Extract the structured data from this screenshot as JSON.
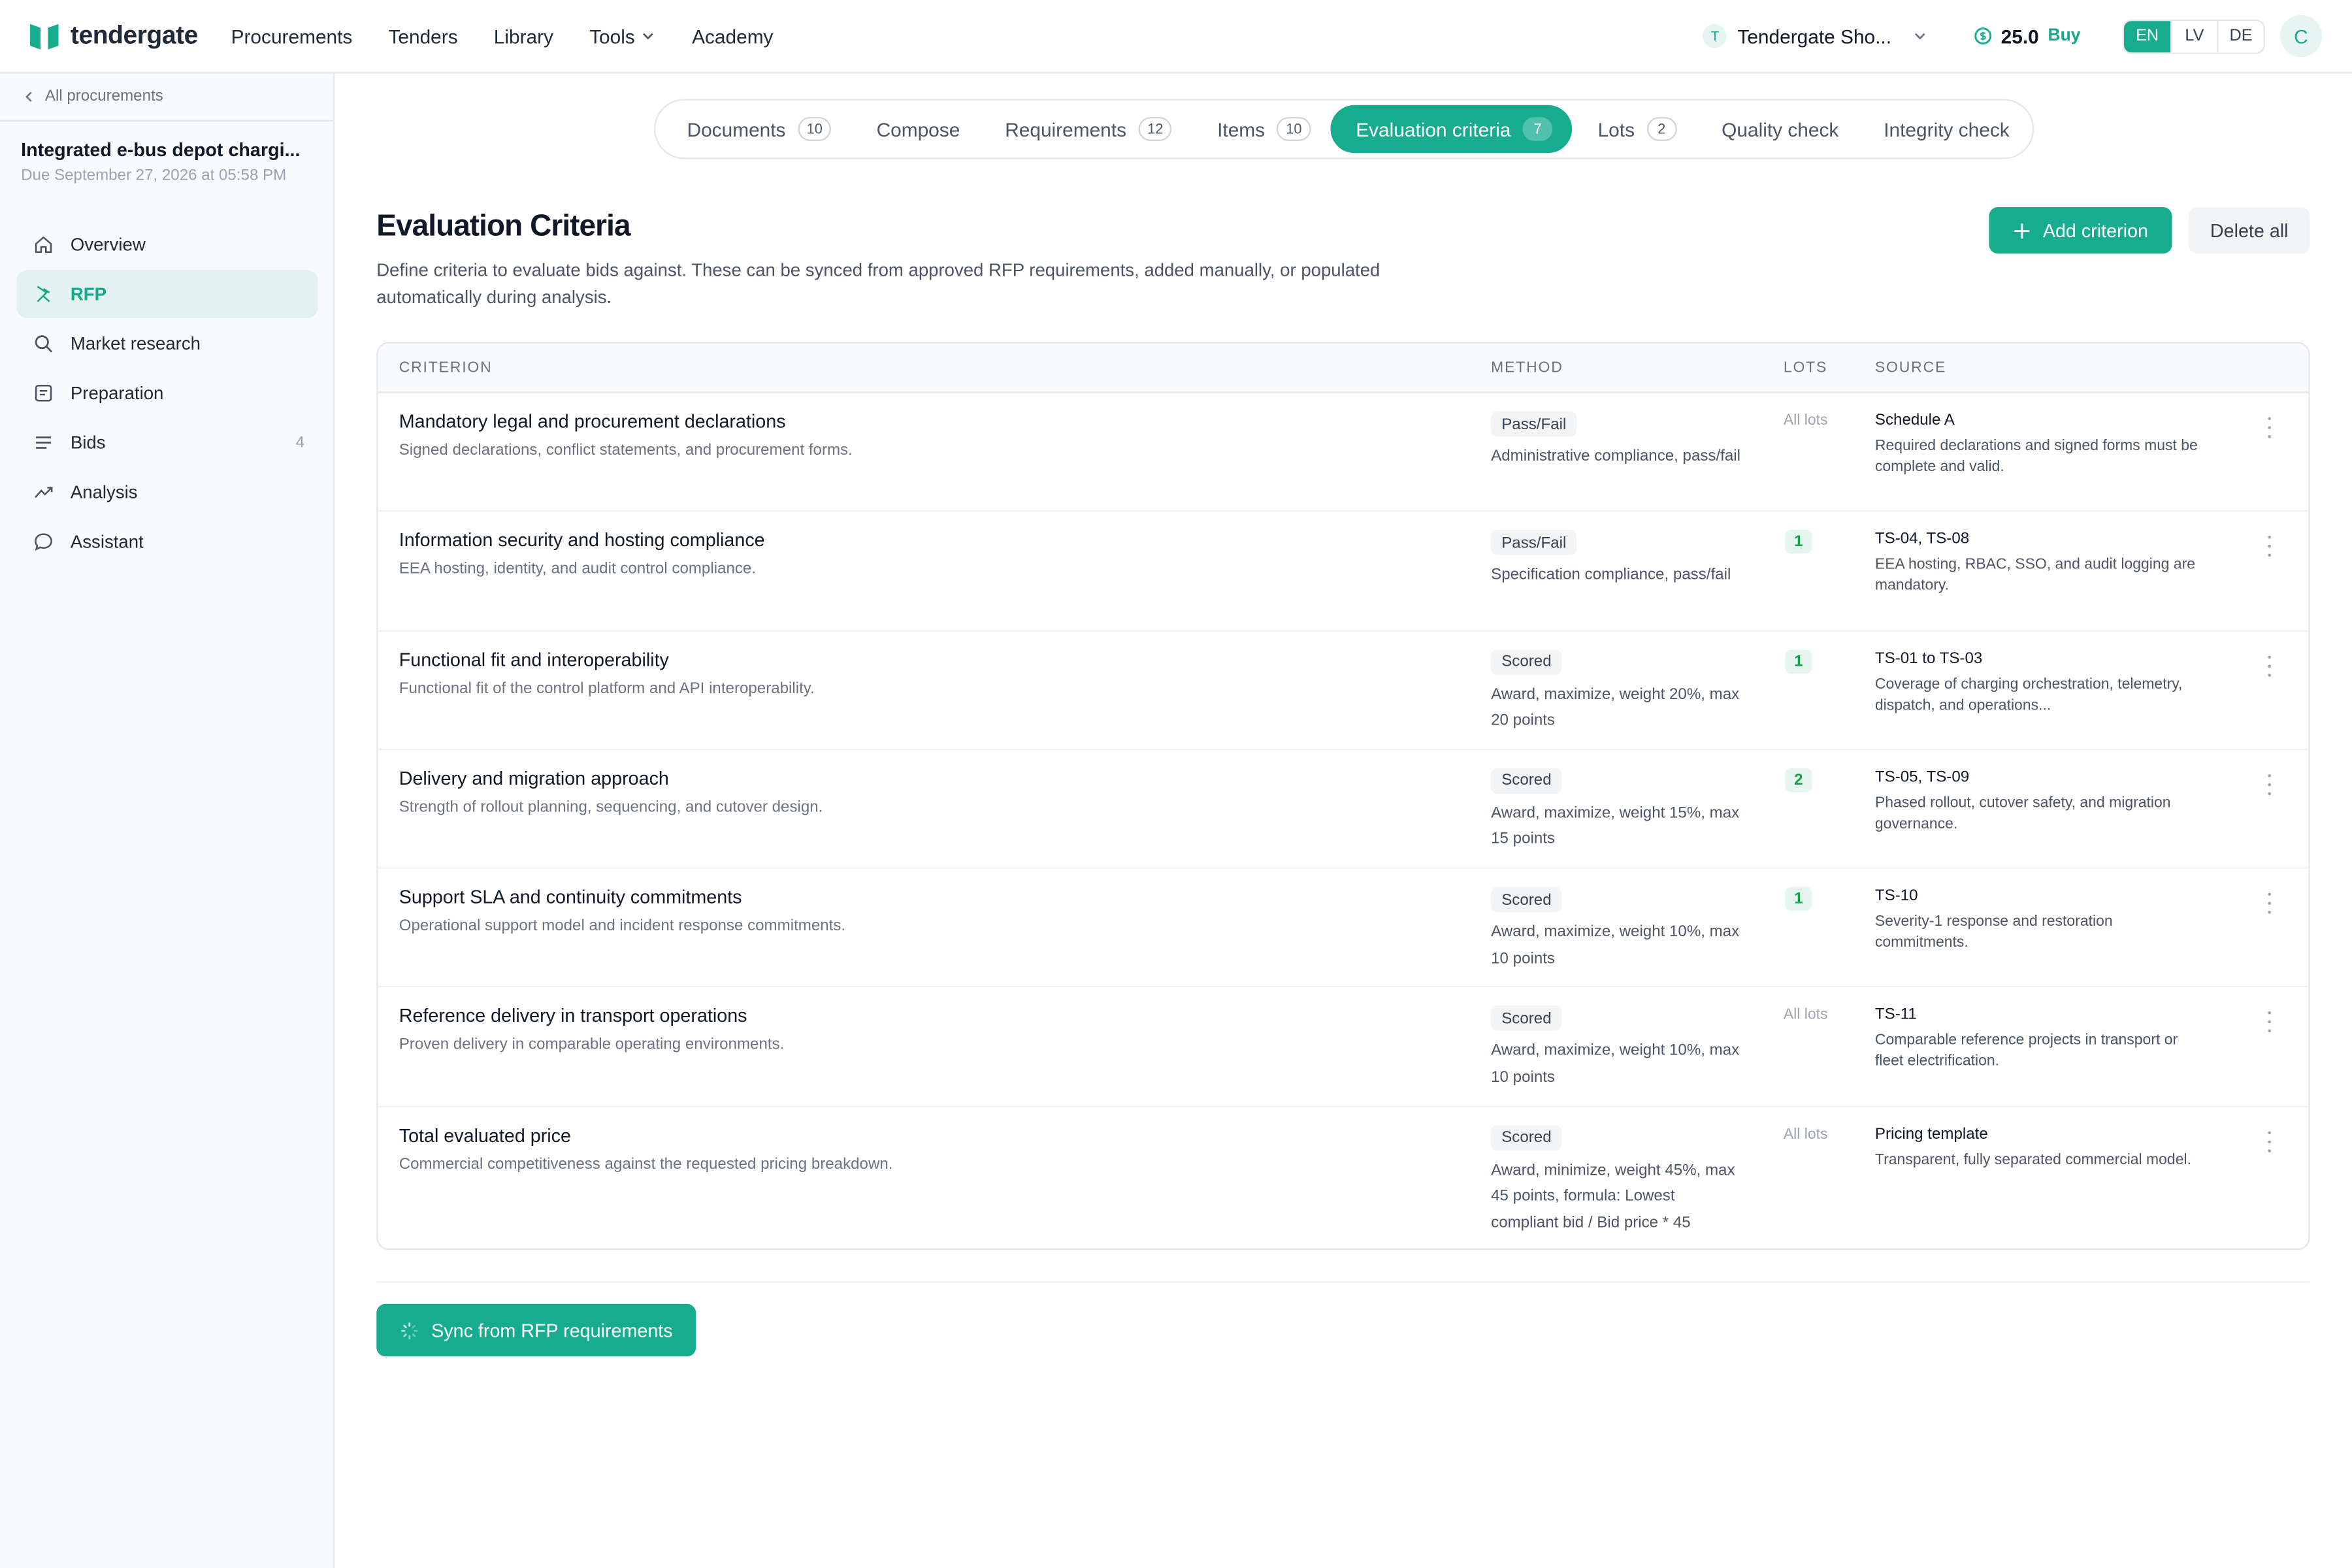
{
  "app": {
    "brand": "tendergate"
  },
  "topnav": [
    {
      "label": "Procurements"
    },
    {
      "label": "Tenders"
    },
    {
      "label": "Library"
    },
    {
      "label": "Tools",
      "has_dropdown": true
    },
    {
      "label": "Academy"
    }
  ],
  "org": {
    "initial": "T",
    "name": "Tendergate Sho..."
  },
  "credits": {
    "value": "25.0",
    "buy_label": "Buy"
  },
  "languages": [
    {
      "code": "EN",
      "active": true
    },
    {
      "code": "LV",
      "active": false
    },
    {
      "code": "DE",
      "active": false
    }
  ],
  "user": {
    "initial": "C"
  },
  "sidebar": {
    "back_label": "All procurements",
    "project_title": "Integrated e-bus depot chargi...",
    "project_due": "Due September 27, 2026 at 05:58 PM",
    "items": [
      {
        "label": "Overview",
        "icon": "home-icon",
        "active": false,
        "count": ""
      },
      {
        "label": "RFP",
        "icon": "rfp-icon",
        "active": true,
        "count": ""
      },
      {
        "label": "Market research",
        "icon": "search-icon",
        "active": false,
        "count": ""
      },
      {
        "label": "Preparation",
        "icon": "preparation-icon",
        "active": false,
        "count": ""
      },
      {
        "label": "Bids",
        "icon": "list-icon",
        "active": false,
        "count": "4"
      },
      {
        "label": "Analysis",
        "icon": "trend-icon",
        "active": false,
        "count": ""
      },
      {
        "label": "Assistant",
        "icon": "chat-icon",
        "active": false,
        "count": ""
      }
    ]
  },
  "tabs": [
    {
      "label": "Documents",
      "count": "10",
      "active": false
    },
    {
      "label": "Compose",
      "count": "",
      "active": false
    },
    {
      "label": "Requirements",
      "count": "12",
      "active": false
    },
    {
      "label": "Items",
      "count": "10",
      "active": false
    },
    {
      "label": "Evaluation criteria",
      "count": "7",
      "active": true
    },
    {
      "label": "Lots",
      "count": "2",
      "active": false
    },
    {
      "label": "Quality check",
      "count": "",
      "active": false
    },
    {
      "label": "Integrity check",
      "count": "",
      "active": false
    }
  ],
  "page": {
    "title": "Evaluation Criteria",
    "description": "Define criteria to evaluate bids against. These can be synced from approved RFP requirements, added manually, or populated automatically during analysis.",
    "add_button": "Add criterion",
    "delete_button": "Delete all",
    "sync_button": "Sync from RFP requirements"
  },
  "table": {
    "columns": [
      "CRITERION",
      "METHOD",
      "LOTS",
      "SOURCE"
    ],
    "rows": [
      {
        "title": "Mandatory legal and procurement declarations",
        "desc": "Signed declarations, conflict statements, and procurement forms.",
        "method": "Pass/Fail",
        "method_desc": "Administrative compliance, pass/fail",
        "lots": "All lots",
        "lots_is_badge": false,
        "source_title": "Schedule A",
        "source_desc": "Required declarations and signed forms must be complete and valid."
      },
      {
        "title": "Information security and hosting compliance",
        "desc": "EEA hosting, identity, and audit control compliance.",
        "method": "Pass/Fail",
        "method_desc": "Specification compliance, pass/fail",
        "lots": "1",
        "lots_is_badge": true,
        "source_title": "TS-04, TS-08",
        "source_desc": "EEA hosting, RBAC, SSO, and audit logging are mandatory."
      },
      {
        "title": "Functional fit and interoperability",
        "desc": "Functional fit of the control platform and API interoperability.",
        "method": "Scored",
        "method_desc": "Award, maximize, weight 20%, max 20 points",
        "lots": "1",
        "lots_is_badge": true,
        "source_title": "TS-01 to TS-03",
        "source_desc": "Coverage of charging orchestration, telemetry, dispatch, and operations..."
      },
      {
        "title": "Delivery and migration approach",
        "desc": "Strength of rollout planning, sequencing, and cutover design.",
        "method": "Scored",
        "method_desc": "Award, maximize, weight 15%, max 15 points",
        "lots": "2",
        "lots_is_badge": true,
        "source_title": "TS-05, TS-09",
        "source_desc": "Phased rollout, cutover safety, and migration governance."
      },
      {
        "title": "Support SLA and continuity commitments",
        "desc": "Operational support model and incident response commitments.",
        "method": "Scored",
        "method_desc": "Award, maximize, weight 10%, max 10 points",
        "lots": "1",
        "lots_is_badge": true,
        "source_title": "TS-10",
        "source_desc": "Severity-1 response and restoration commitments."
      },
      {
        "title": "Reference delivery in transport operations",
        "desc": "Proven delivery in comparable operating environments.",
        "method": "Scored",
        "method_desc": "Award, maximize, weight 10%, max 10 points",
        "lots": "All lots",
        "lots_is_badge": false,
        "source_title": "TS-11",
        "source_desc": "Comparable reference projects in transport or fleet electrification."
      },
      {
        "title": "Total evaluated price",
        "desc": "Commercial competitiveness against the requested pricing breakdown.",
        "method": "Scored",
        "method_desc": "Award, minimize, weight 45%, max 45 points, formula: Lowest compliant bid / Bid price * 45",
        "lots": "All lots",
        "lots_is_badge": false,
        "source_title": "Pricing template",
        "source_desc": "Transparent, fully separated commercial model."
      }
    ]
  },
  "colors": {
    "accent": "#18ac8f",
    "accent_light": "#e4f2ef",
    "lot_badge_bg": "#e6f5ef",
    "lot_badge_text": "#16a34a"
  }
}
